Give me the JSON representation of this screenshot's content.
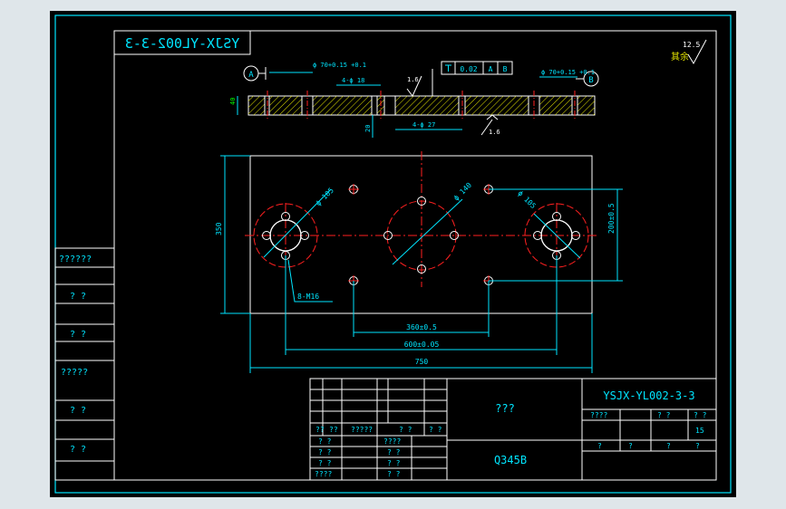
{
  "drawing": {
    "mirrored_title": "YSJX-YL002-3-3",
    "drawing_number": "YSJX-YL002-3-3",
    "part_name": "???",
    "material": "Q345B",
    "sheet_total": "15",
    "roughness_note": "其余",
    "roughness_value": "12.5",
    "colors": {
      "frame": "#00e5ff",
      "outline": "#ffffff",
      "dim": "#00e5ff",
      "text": "#00e5ff",
      "center": "#ff2020",
      "hatch": "#e6e600",
      "label": "#00ff00",
      "leader": "#ff00ff"
    }
  },
  "left_column": {
    "labels": [
      "??????",
      "?  ?",
      "?  ?",
      "?????",
      "?  ?",
      "?  ?"
    ]
  },
  "title_block": {
    "row1": [
      "??",
      "??",
      "?????",
      "?  ?",
      "?  ?"
    ],
    "rows": [
      {
        "a": "?  ?",
        "b": "????"
      },
      {
        "a": "?  ?",
        "b": "?  ?"
      },
      {
        "a": "?  ?",
        "b": "?  ?"
      },
      {
        "a": "????",
        "b": "?  ?"
      }
    ],
    "right_hdr": [
      "????",
      "?  ?",
      "?  ?"
    ],
    "right_bottom": [
      "?",
      "?",
      "?",
      "?"
    ]
  },
  "section": {
    "datum_a": "A",
    "datum_b": "B",
    "dim_left_bore": "ϕ 70+0.15 +0.1",
    "dim_right_bore": "ϕ 70+0.15 +0.1",
    "holes_top": "4-ϕ 18",
    "holes_bottom": "4-ϕ 27",
    "depth": "20",
    "thickness": "40",
    "roughness1": "1.6",
    "roughness2": "1.6",
    "tolerance_value": "0.02",
    "tolerance_datum_a": "A",
    "tolerance_datum_b": "B"
  },
  "plan": {
    "dia_left": "ϕ 105",
    "dia_center": "ϕ 140",
    "dia_right": "ϕ 105",
    "threads": "8-M16",
    "height": "350",
    "pitch_v": "200±0.5",
    "pitch_inner": "360±0.5",
    "pitch_outer": "600±0.05",
    "overall": "750"
  }
}
